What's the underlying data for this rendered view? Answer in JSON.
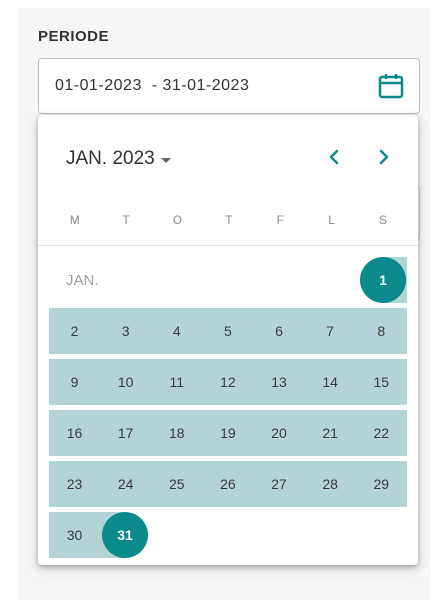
{
  "period": {
    "label": "PERIODE",
    "value": "01-01-2023  - 31-01-2023"
  },
  "colors": {
    "accent": "#0a8a8a",
    "range": "#b3d4d6"
  },
  "calendar": {
    "month_label": "JAN. 2023",
    "prev_icon": "chevron-left-icon",
    "next_icon": "chevron-right-icon",
    "weekdays": [
      "M",
      "T",
      "O",
      "T",
      "F",
      "L",
      "S"
    ],
    "month_short": "JAN.",
    "selected_start": "1",
    "selected_end": "31",
    "weeks": [
      [
        "2",
        "3",
        "4",
        "5",
        "6",
        "7",
        "8"
      ],
      [
        "9",
        "10",
        "11",
        "12",
        "13",
        "14",
        "15"
      ],
      [
        "16",
        "17",
        "18",
        "19",
        "20",
        "21",
        "22"
      ],
      [
        "23",
        "24",
        "25",
        "26",
        "27",
        "28",
        "29"
      ],
      [
        "30"
      ]
    ]
  }
}
